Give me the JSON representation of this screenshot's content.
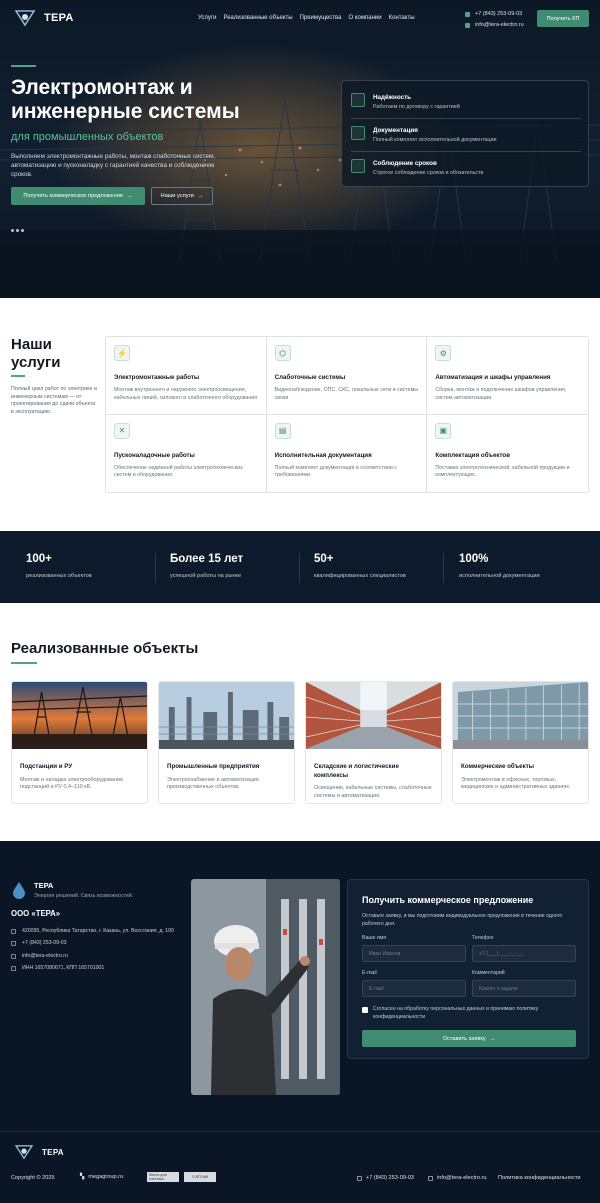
{
  "brand": {
    "name": "ТЕРА"
  },
  "nav": {
    "items": [
      "Услуги",
      "Реализованные объекты",
      "Преимущества",
      "О компании",
      "Контакты"
    ],
    "phone": "+7 (843) 253-09-03",
    "email": "info@tera-electro.ru",
    "kp_button": "Получить КП"
  },
  "hero": {
    "title": "Электромонтаж и инженерные системы",
    "subtitle": "для промышленных объектов",
    "description": "Выполняем электромонтажные работы, монтаж слаботочных систем, автоматизацию и пусконаладку с гарантией качества и соблюдением сроков.",
    "primary_button": "Получить коммерческое предложение",
    "secondary_button": "Наши услуги",
    "features": [
      {
        "title": "Надёжность",
        "text": "Работаем по договору с гарантией",
        "icon": "shield-check-icon"
      },
      {
        "title": "Документация",
        "text": "Полный комплект исполнительной документации",
        "icon": "document-icon"
      },
      {
        "title": "Соблюдение сроков",
        "text": "Строгое соблюдение сроков и обязательств",
        "icon": "clock-icon"
      }
    ]
  },
  "services": {
    "title": "Наши услуги",
    "description": "Полный цикл работ по электрике и инженерным системам — от проектирования до сдачи объекта в эксплуатацию.",
    "items": [
      {
        "title": "Электромонтажные работы",
        "text": "Монтаж внутреннего и наружного электроосвещения, кабельных линий, силового и слаботочного оборудования",
        "icon": "lightning-icon",
        "glyph": "⚡"
      },
      {
        "title": "Слаботочные системы",
        "text": "Видеонаблюдение, ОПС, СКС, локальные сети и системы связи",
        "icon": "network-icon",
        "glyph": "⌬"
      },
      {
        "title": "Автоматизация и шкафы управления",
        "text": "Сборка, монтаж и подключение шкафов управления, систем автоматизации.",
        "icon": "gear-icon",
        "glyph": "⚙"
      },
      {
        "title": "Пусконаладочные работы",
        "text": "Обеспечение надёжной работы электротехнических систем и оборудования.",
        "icon": "tools-icon",
        "glyph": "✕"
      },
      {
        "title": "Исполнительная документация",
        "text": "Полный комплект документации в соответствии с требованиями.",
        "icon": "document-icon",
        "glyph": "▤"
      },
      {
        "title": "Комплектация объектов",
        "text": "Поставка электротехнической, кабельной продукции и комплектующих.",
        "icon": "box-icon",
        "glyph": "▣"
      }
    ]
  },
  "stats": [
    {
      "value": "100+",
      "label": "реализованных объектов"
    },
    {
      "value": "Более 15 лет",
      "label": "успешной работы на рынке"
    },
    {
      "value": "50+",
      "label": "квалифицированных специалистов"
    },
    {
      "value": "100%",
      "label": "исполнительной документации"
    }
  ],
  "projects": {
    "title": "Реализованные объекты",
    "items": [
      {
        "title": "Подстанции и РУ",
        "text": "Монтаж и наладка электрооборудования подстанций и РУ 0,4–110 кВ."
      },
      {
        "title": "Промышленные предприятия",
        "text": "Электроснабжение и автоматизация производственных объектов."
      },
      {
        "title": "Складские и логистические комплексы",
        "text": "Освещение, кабельные системы, слаботочные системы и автоматизация."
      },
      {
        "title": "Коммерческие объекты",
        "text": "Электромонтаж в офисных, торговых, медицинских и административных зданиях."
      }
    ]
  },
  "contact": {
    "brand": "ТЕРА",
    "slogan": "Энергия решений. Связь возможностей.",
    "org": "ООО «ТЕРА»",
    "address": "420095, Республика Татарстан, г. Казань, ул. Восстания, д. 100",
    "phone": "+7 (843) 253-09-03",
    "email": "info@tera-electro.ru",
    "inn": "ИНН 1657080671, КПП 165701001"
  },
  "form": {
    "title": "Получить коммерческое предложение",
    "description": "Оставьте заявку, и мы подготовим индивидуальное предложение в течение одного рабочего дня.",
    "name_label": "Ваше имя",
    "name_placeholder": "Иван Иванов",
    "phone_label": "Телефон",
    "phone_placeholder": "+7 (___) ___-__-__",
    "email_label": "E-mail",
    "email_placeholder": "E-mail",
    "comment_label": "Комментарий",
    "comment_placeholder": "Кратко о задаче",
    "consent": "Согласен на обработку персональных данных и принимаю политику конфиденциальности",
    "submit": "Оставить заявку"
  },
  "footer": {
    "brand": "ТЕРА",
    "copyright": "Copyright © 2025",
    "partner": "megagroup.ru",
    "badge1": "Место для счетчика",
    "badge2": "СЧЕТЧИК",
    "phone": "+7 (843) 253-09-03",
    "email": "info@tera-electro.ru",
    "privacy": "Политика конфиденциальности"
  },
  "colors": {
    "accent": "#3f8c71",
    "accent_light": "#59c39c",
    "dark": "#0a1625"
  }
}
